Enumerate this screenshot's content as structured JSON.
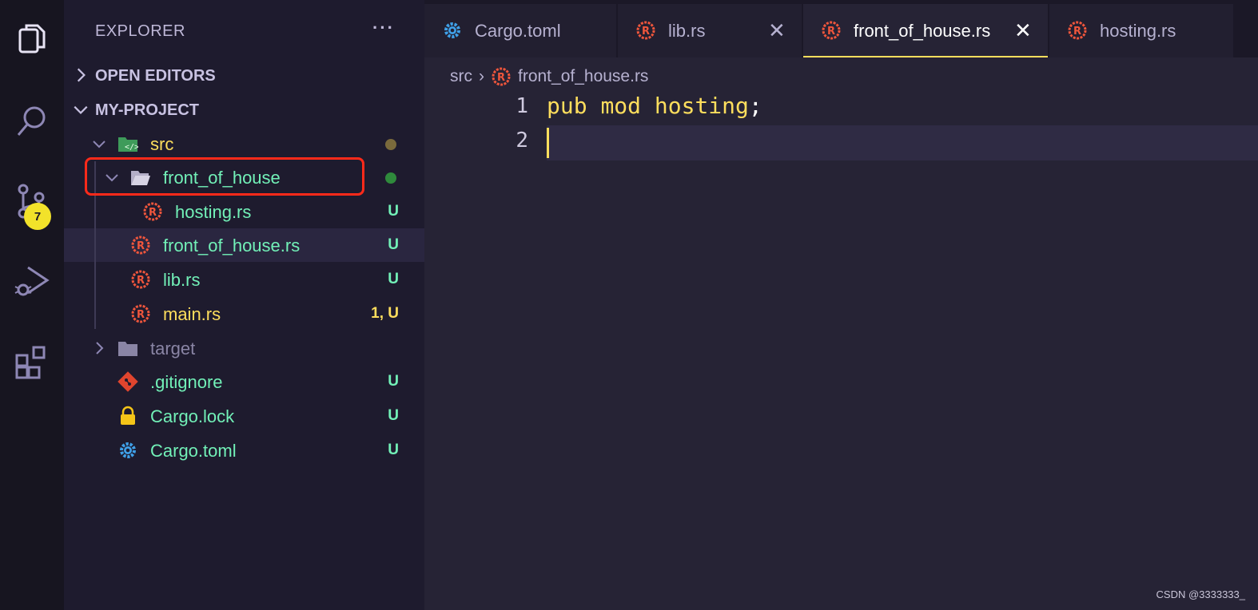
{
  "colors": {
    "activity_bg": "#171520",
    "sidebar_bg": "#1e1b2e",
    "editor_bg": "#262335",
    "untracked_green": "#72f1b8",
    "modified_yellow": "#fede5d",
    "highlight_red": "#ff2a1a",
    "rust_icon": "#f0563c"
  },
  "activity_bar": {
    "items": [
      {
        "icon": "files-icon"
      },
      {
        "icon": "search-icon"
      },
      {
        "icon": "source-control-icon"
      },
      {
        "icon": "run-debug-icon"
      },
      {
        "icon": "extensions-icon"
      }
    ],
    "source_control_badge": "7"
  },
  "sidebar": {
    "title": "EXPLORER",
    "more": "···",
    "open_editors_label": "OPEN EDITORS",
    "project_label": "MY-PROJECT",
    "tree": [
      {
        "name": "src",
        "type": "folder",
        "expanded": true,
        "status_dot": "yellow"
      },
      {
        "name": "front_of_house",
        "type": "folder",
        "expanded": true,
        "status_dot": "green"
      },
      {
        "name": "hosting.rs",
        "type": "rust-file",
        "status": "U"
      },
      {
        "name": "front_of_house.rs",
        "type": "rust-file",
        "status": "U"
      },
      {
        "name": "lib.rs",
        "type": "rust-file",
        "status": "U"
      },
      {
        "name": "main.rs",
        "type": "rust-file",
        "status": "1, U"
      },
      {
        "name": "target",
        "type": "folder",
        "expanded": false
      },
      {
        "name": ".gitignore",
        "type": "git-file",
        "status": "U"
      },
      {
        "name": "Cargo.lock",
        "type": "lock-file",
        "status": "U"
      },
      {
        "name": "Cargo.toml",
        "type": "gear-file",
        "status": "U"
      }
    ]
  },
  "editor": {
    "tabs": [
      {
        "label": "Cargo.toml",
        "icon": "gear-icon"
      },
      {
        "label": "lib.rs",
        "icon": "rust-icon",
        "close": "✕"
      },
      {
        "label": "front_of_house.rs",
        "icon": "rust-icon",
        "close": "✕",
        "active": true
      },
      {
        "label": "hosting.rs",
        "icon": "rust-icon"
      }
    ],
    "breadcrumb": [
      "src",
      "front_of_house.rs"
    ],
    "lines": [
      {
        "number": "1",
        "tokens": {
          "kw1": "pub",
          "kw2": "mod",
          "ident": "hosting",
          "punct": ";"
        }
      },
      {
        "number": "2",
        "text": ""
      }
    ]
  },
  "watermark": "CSDN @3333333_"
}
